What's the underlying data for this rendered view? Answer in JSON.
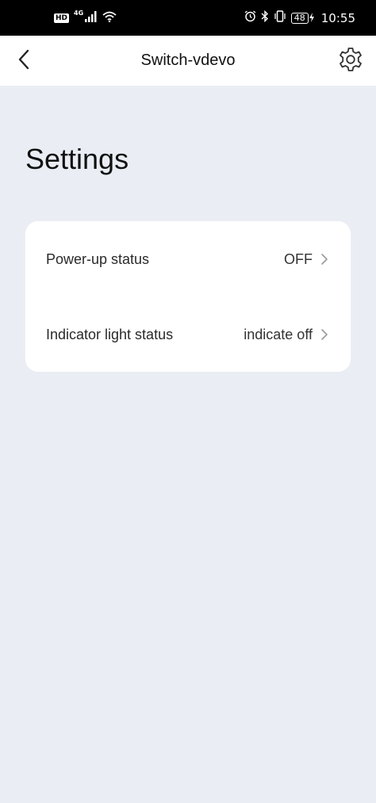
{
  "status_bar": {
    "hd_label": "HD",
    "network_label": "4G",
    "battery_level": "48",
    "time": "10:55"
  },
  "app_bar": {
    "title": "Switch-vdevo"
  },
  "page": {
    "title": "Settings"
  },
  "settings": {
    "items": [
      {
        "label": "Power-up status",
        "value": "OFF"
      },
      {
        "label": "Indicator light status",
        "value": "indicate off"
      }
    ]
  },
  "colors": {
    "background": "#eaeef4",
    "card": "#ffffff",
    "status_bar": "#000000"
  },
  "icons": {
    "back": "chevron-left-icon",
    "settings": "gear-icon",
    "row_arrow": "chevron-right-icon"
  }
}
